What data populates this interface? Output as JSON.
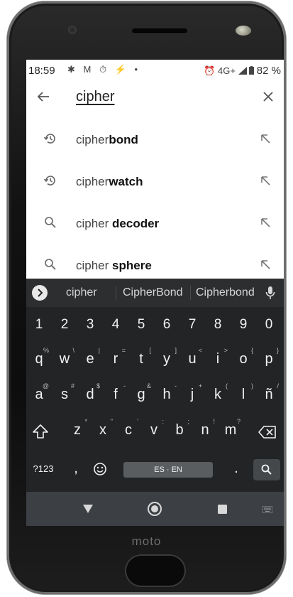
{
  "status": {
    "time": "18:59",
    "left_icons": "✱ M ⏱ ⚡ •",
    "right_icons": "⏰ 4G+",
    "battery": "82 %"
  },
  "search": {
    "query": "cipher"
  },
  "suggestions": [
    {
      "prefix": "cipher",
      "completion": "bond",
      "icon": "history-icon"
    },
    {
      "prefix": "cipher",
      "completion": "watch",
      "icon": "history-icon"
    },
    {
      "prefix": "cipher ",
      "completion": "decoder",
      "icon": "search-icon"
    },
    {
      "prefix": "cipher ",
      "completion": "sphere",
      "icon": "search-icon"
    }
  ],
  "keyboard": {
    "suggestion_words": [
      "cipher",
      "CipherBond",
      "Cipherbond"
    ],
    "numbers": [
      "1",
      "2",
      "3",
      "4",
      "5",
      "6",
      "7",
      "8",
      "9",
      "0"
    ],
    "row1": [
      "q",
      "w",
      "e",
      "r",
      "t",
      "y",
      "u",
      "i",
      "o",
      "p"
    ],
    "row1_alt": [
      "%",
      "\\",
      "|",
      "=",
      "[",
      "]",
      "<",
      ">",
      "{",
      "}"
    ],
    "row2": [
      "a",
      "s",
      "d",
      "f",
      "g",
      "h",
      "j",
      "k",
      "l",
      "ñ"
    ],
    "row2_alt": [
      "@",
      "#",
      "$",
      "-",
      "&",
      "-",
      "+",
      "(",
      ")",
      "/"
    ],
    "row3": [
      "z",
      "x",
      "c",
      "v",
      "b",
      "n",
      "m"
    ],
    "row3_alt": [
      "*",
      "\"",
      "'",
      ":",
      ";",
      "!",
      "?"
    ],
    "mode_key": "?123",
    "comma": ",",
    "space_label": "ES · EN",
    "period": "."
  },
  "device": {
    "brand": "moto"
  },
  "colors": {
    "keyboard_bg": "#222425",
    "nav_bg": "#3c3f44"
  }
}
